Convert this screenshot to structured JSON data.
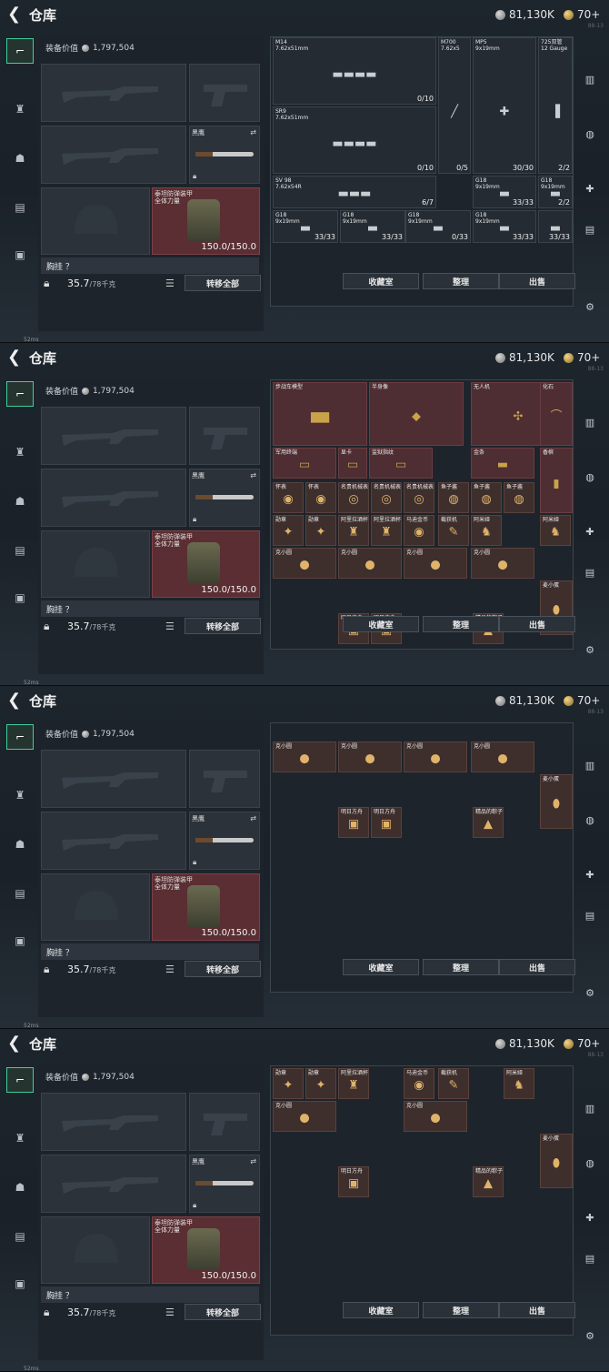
{
  "app": {
    "title": "仓库",
    "back_icon": "chevron-left-icon"
  },
  "currency": {
    "silver": "81,130K",
    "gold": "70+",
    "fineprint": "88-13"
  },
  "equipment": {
    "value_label": "装备价值",
    "value": "1,797,504",
    "knife_label": "黑鹰",
    "armor_label": "泰坦防弹装甲\n全体力量",
    "armor_durability": "150.0/150.0",
    "chest_label": "胸挂 ？",
    "weight": "35.7",
    "weight_max": "/78千克",
    "transfer_all": "转移全部"
  },
  "buttons": {
    "collection": "收藏室",
    "sort": "整理",
    "sell": "出售"
  },
  "status": {
    "ping": "52ms"
  },
  "screens": [
    {
      "name": "weapons",
      "cells": [
        {
          "name": "M14\n7.62x51mm",
          "count": "0/10",
          "tone": "plain",
          "glyph": "▬▬▬▬"
        },
        {
          "name": "M700\n7.62x5",
          "count": "0/5",
          "tone": "plain",
          "glyph": "╱"
        },
        {
          "name": "MP5\n9x19mm",
          "count": "30/30",
          "tone": "plain",
          "glyph": "✚"
        },
        {
          "name": "725双管\n12 Gauge",
          "count": "2/2",
          "tone": "plain",
          "glyph": "▐"
        },
        {
          "name": "SR9\n7.62x51mm",
          "count": "0/10",
          "tone": "plain",
          "glyph": "▬▬▬▬"
        },
        {
          "name": "SV 98\n7.62x54R",
          "count": "6/7",
          "tone": "plain",
          "glyph": "▬▬▬"
        },
        {
          "name": "G18\n9x19mm",
          "count": "33/33",
          "tone": "plain",
          "glyph": "▬"
        },
        {
          "name": "G18\n9x19mm",
          "count": "2/2",
          "tone": "plain",
          "glyph": "▬"
        },
        {
          "name": "G18\n9x19mm",
          "count": "33/33",
          "tone": "plain",
          "glyph": "▬"
        },
        {
          "name": "G18\n9x19mm",
          "count": "33/33",
          "tone": "plain",
          "glyph": "▬"
        },
        {
          "name": "G18\n9x19mm",
          "count": "0/33",
          "tone": "plain",
          "glyph": "▬"
        },
        {
          "name": "G18\n9x19mm",
          "count": "33/33",
          "tone": "plain",
          "glyph": "▬"
        },
        {
          "name": "",
          "count": "33/33",
          "tone": "plain",
          "glyph": "▬"
        }
      ]
    },
    {
      "name": "valuables",
      "cells": [
        {
          "name": "步战车模型",
          "count": "",
          "tone": "red",
          "glyph": "▆▆"
        },
        {
          "name": "半身像",
          "count": "",
          "tone": "red",
          "glyph": "◆"
        },
        {
          "name": "无人机",
          "count": "",
          "tone": "red",
          "glyph": "✣"
        },
        {
          "name": "化石",
          "count": "",
          "tone": "red",
          "glyph": "⌒"
        },
        {
          "name": "军用终端",
          "count": "",
          "tone": "red",
          "glyph": "▭"
        },
        {
          "name": "显卡",
          "count": "",
          "tone": "red",
          "glyph": "▭"
        },
        {
          "name": "监狱指纹",
          "count": "",
          "tone": "red",
          "glyph": "▭"
        },
        {
          "name": "金条",
          "count": "",
          "tone": "red",
          "glyph": "▬"
        },
        {
          "name": "香槟",
          "count": "",
          "tone": "red",
          "glyph": "▮"
        },
        {
          "name": "怀表",
          "count": "",
          "tone": "brown",
          "glyph": "◉"
        },
        {
          "name": "怀表",
          "count": "",
          "tone": "brown",
          "glyph": "◉"
        },
        {
          "name": "名贵机械表",
          "count": "",
          "tone": "brown",
          "glyph": "◎"
        },
        {
          "name": "名贵机械表",
          "count": "",
          "tone": "brown",
          "glyph": "◎"
        },
        {
          "name": "名贵机械表",
          "count": "",
          "tone": "brown",
          "glyph": "◎"
        },
        {
          "name": "鱼子酱",
          "count": "",
          "tone": "brown",
          "glyph": "◍"
        },
        {
          "name": "鱼子酱",
          "count": "",
          "tone": "brown",
          "glyph": "◍"
        },
        {
          "name": "鱼子酱",
          "count": "",
          "tone": "brown",
          "glyph": "◍"
        },
        {
          "name": "勋章",
          "count": "",
          "tone": "brown",
          "glyph": "✦"
        },
        {
          "name": "勋章",
          "count": "",
          "tone": "brown",
          "glyph": "✦"
        },
        {
          "name": "阿里拉酒杯",
          "count": "",
          "tone": "brown",
          "glyph": "♜"
        },
        {
          "name": "阿里拉酒杯",
          "count": "",
          "tone": "brown",
          "glyph": "♜"
        },
        {
          "name": "马迪金币",
          "count": "",
          "tone": "brown",
          "glyph": "◉"
        },
        {
          "name": "截获机",
          "count": "",
          "tone": "brown",
          "glyph": "✎"
        },
        {
          "name": "阿米娅",
          "count": "",
          "tone": "brown",
          "glyph": "♞"
        },
        {
          "name": "阿米娅",
          "count": "",
          "tone": "brown",
          "glyph": "♞"
        },
        {
          "name": "克小圆",
          "count": "",
          "tone": "brown",
          "glyph": "●"
        },
        {
          "name": "克小圆",
          "count": "",
          "tone": "brown",
          "glyph": "●"
        },
        {
          "name": "克小圆",
          "count": "",
          "tone": "brown",
          "glyph": "●"
        },
        {
          "name": "克小圆",
          "count": "",
          "tone": "brown",
          "glyph": "●"
        },
        {
          "name": "麦小蛋",
          "count": "",
          "tone": "brown",
          "glyph": "⬮"
        },
        {
          "name": "明日方舟",
          "count": "",
          "tone": "brown",
          "glyph": "▣"
        },
        {
          "name": "明日方舟",
          "count": "",
          "tone": "brown",
          "glyph": "▣"
        },
        {
          "name": "精品的粽子",
          "count": "",
          "tone": "brown",
          "glyph": "▲"
        }
      ]
    },
    {
      "name": "valuables-scrolled",
      "cells": [
        {
          "name": "克小圆",
          "count": "",
          "tone": "brown",
          "glyph": "●"
        },
        {
          "name": "克小圆",
          "count": "",
          "tone": "brown",
          "glyph": "●"
        },
        {
          "name": "克小圆",
          "count": "",
          "tone": "brown",
          "glyph": "●"
        },
        {
          "name": "克小圆",
          "count": "",
          "tone": "brown",
          "glyph": "●"
        },
        {
          "name": "麦小蛋",
          "count": "",
          "tone": "brown",
          "glyph": "⬮"
        },
        {
          "name": "明日方舟",
          "count": "",
          "tone": "brown",
          "glyph": "▣"
        },
        {
          "name": "明日方舟",
          "count": "",
          "tone": "brown",
          "glyph": "▣"
        },
        {
          "name": "精品的粽子",
          "count": "",
          "tone": "brown",
          "glyph": "▲"
        }
      ]
    },
    {
      "name": "valuables-bottom",
      "cells": [
        {
          "name": "勋章",
          "count": "",
          "tone": "brown",
          "glyph": "✦"
        },
        {
          "name": "勋章",
          "count": "",
          "tone": "brown",
          "glyph": "✦"
        },
        {
          "name": "阿里拉酒杯",
          "count": "",
          "tone": "brown",
          "glyph": "♜"
        },
        {
          "name": "马迪金币",
          "count": "",
          "tone": "brown",
          "glyph": "◉"
        },
        {
          "name": "截获机",
          "count": "",
          "tone": "brown",
          "glyph": "✎"
        },
        {
          "name": "阿米娅",
          "count": "",
          "tone": "brown",
          "glyph": "♞"
        },
        {
          "name": "克小圆",
          "count": "",
          "tone": "brown",
          "glyph": "●"
        },
        {
          "name": "克小圆",
          "count": "",
          "tone": "brown",
          "glyph": "●"
        },
        {
          "name": "麦小蛋",
          "count": "",
          "tone": "brown",
          "glyph": "⬮"
        },
        {
          "name": "明日方舟",
          "count": "",
          "tone": "brown",
          "glyph": "▣"
        },
        {
          "name": "精品的粽子",
          "count": "",
          "tone": "brown",
          "glyph": "▲"
        }
      ]
    }
  ]
}
